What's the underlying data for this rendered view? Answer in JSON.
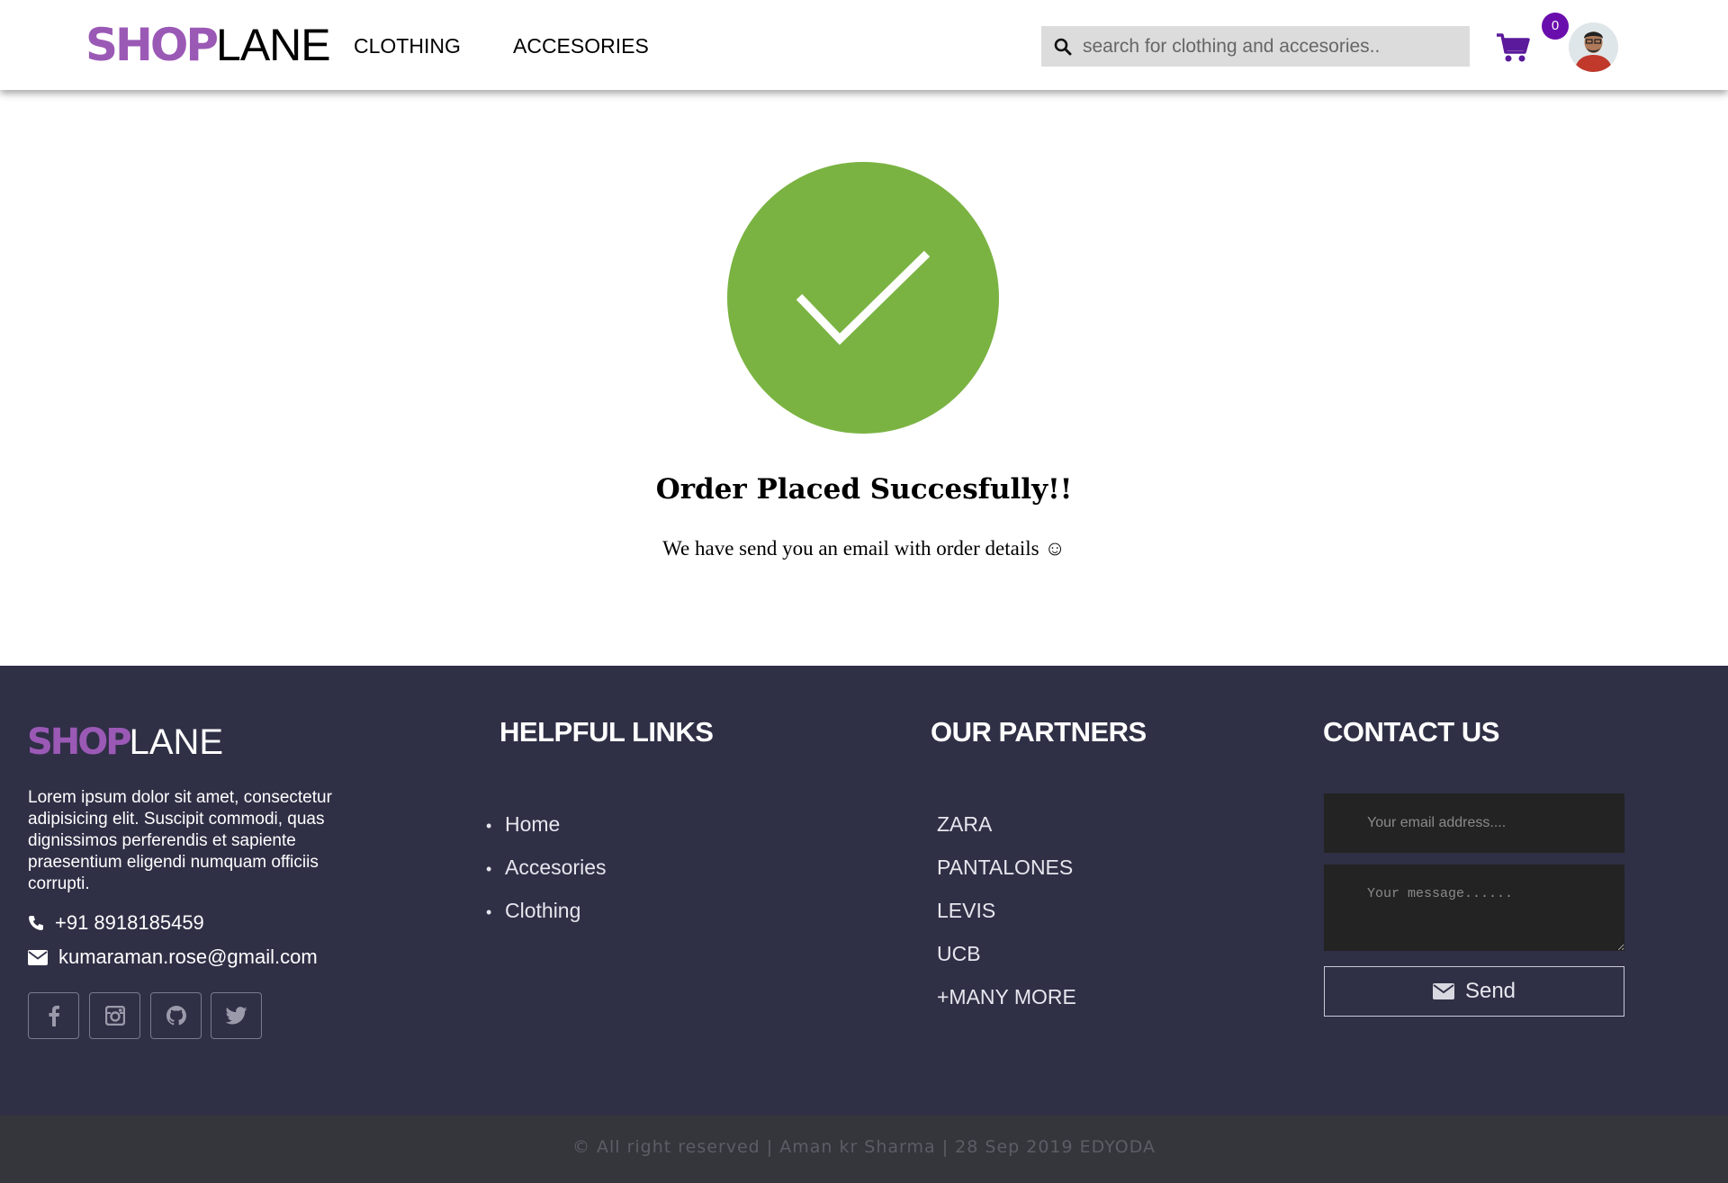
{
  "header": {
    "logo_shop": "SHOP",
    "logo_lane": "LANE",
    "nav": [
      {
        "label": "CLOTHING"
      },
      {
        "label": "ACCESORIES"
      }
    ],
    "search_placeholder": "search for clothing and accesories..",
    "cart_count": "0",
    "cart_icon": "shopping-cart-icon",
    "avatar_icon": "user-avatar"
  },
  "main": {
    "icon": "check-circle-icon",
    "check_color": "#7ab342",
    "title": "Order Placed Succesfully!!",
    "subtitle": "We have send you an email with order details ☺"
  },
  "footer": {
    "logo_shop": "SHOP",
    "logo_lane": "LANE",
    "about": "Lorem ipsum dolor sit amet, consectetur adipisicing elit. Suscipit commodi, quas dignissimos perferendis et sapiente praesentium eligendi numquam officiis corrupti.",
    "phone": "+91 8918185459",
    "email": "kumaraman.rose@gmail.com",
    "social_icons": [
      "facebook-icon",
      "instagram-icon",
      "github-icon",
      "twitter-icon"
    ],
    "helpful_links_heading": "HELPFUL LINKS",
    "helpful_links": [
      "Home",
      "Accesories",
      "Clothing"
    ],
    "partners_heading": "OUR PARTNERS",
    "partners": [
      "ZARA",
      "PANTALONES",
      "LEVIS",
      "UCB",
      "+MANY MORE"
    ],
    "contact_heading": "CONTACT US",
    "email_placeholder": "Your email address....",
    "message_placeholder": "Your message......",
    "send_label": "Send",
    "copyright": "© All right reserved | Aman kr Sharma | 28 Sep 2019 EDYODA"
  },
  "colors": {
    "brand_purple": "#9b59b6",
    "badge_purple": "#6a0dad",
    "cart_purple": "#5b1a9b",
    "footer_bg": "#2f2f46",
    "copyright_bg": "#35363c"
  }
}
